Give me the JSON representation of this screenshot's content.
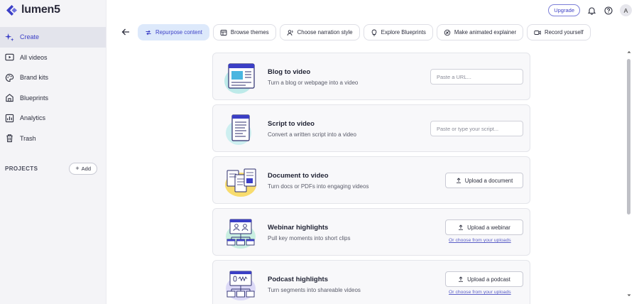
{
  "app": {
    "name": "lumen5",
    "brand_color": "#3b3fc6"
  },
  "sidebar": {
    "items": [
      {
        "label": "Create",
        "icon": "sparkles-icon",
        "active": true
      },
      {
        "label": "All videos",
        "icon": "video-icon"
      },
      {
        "label": "Brand kits",
        "icon": "palette-icon"
      },
      {
        "label": "Blueprints",
        "icon": "blueprint-icon"
      },
      {
        "label": "Analytics",
        "icon": "analytics-icon"
      },
      {
        "label": "Trash",
        "icon": "trash-icon"
      }
    ],
    "projects_label": "PROJECTS",
    "add_label": "Add"
  },
  "header": {
    "upgrade_label": "Upgrade",
    "avatar_initial": "A"
  },
  "tabs": [
    {
      "label": "Repurpose content",
      "icon": "repurpose-icon",
      "active": true
    },
    {
      "label": "Browse themes",
      "icon": "themes-icon"
    },
    {
      "label": "Choose narration style",
      "icon": "narration-icon"
    },
    {
      "label": "Explore Blueprints",
      "icon": "lightbulb-icon"
    },
    {
      "label": "Make animated explainer",
      "icon": "animation-icon"
    },
    {
      "label": "Record yourself",
      "icon": "camera-icon"
    }
  ],
  "cards": [
    {
      "title": "Blog to video",
      "subtitle": "Turn a blog or webpage into a video",
      "placeholder": "Paste a URL..."
    },
    {
      "title": "Script to video",
      "subtitle": "Convert a written script into a video",
      "placeholder": "Paste or type your script..."
    },
    {
      "title": "Document to video",
      "subtitle": "Turn docs or PDFs into engaging videos",
      "button": "Upload a document"
    },
    {
      "title": "Webinar highlights",
      "subtitle": "Pull key moments into short clips",
      "button": "Upload a webinar",
      "link": "Or choose from your uploads"
    },
    {
      "title": "Podcast highlights",
      "subtitle": "Turn segments into shareable videos",
      "button": "Upload a podcast",
      "link": "Or choose from your uploads"
    }
  ]
}
